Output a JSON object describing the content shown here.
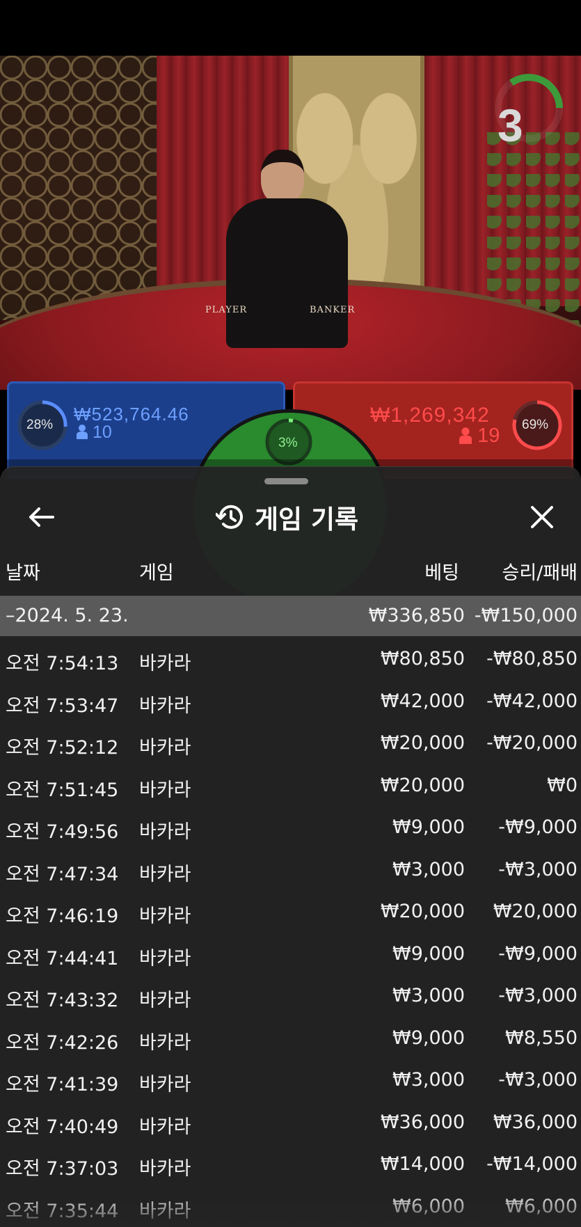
{
  "stream": {
    "countdown": "3",
    "table_left_text": "PLAYER",
    "table_right_text": "BANKER"
  },
  "bets": {
    "player": {
      "percent": "28%",
      "percent_value": 0.28,
      "amount": "₩523,764.46",
      "count": "10"
    },
    "tie": {
      "percent": "3%",
      "percent_value": 0.03
    },
    "banker": {
      "percent": "69%",
      "percent_value": 0.69,
      "amount": "₩1,269,342",
      "count": "19"
    }
  },
  "sheet": {
    "title": "게임 기록",
    "columns": {
      "date": "날짜",
      "game": "게임",
      "bet": "베팅",
      "result": "승리/패배"
    },
    "date_group": {
      "label": "–2024. 5. 23.",
      "bet": "₩336,850",
      "result": "-₩150,000"
    },
    "rows": [
      {
        "time": "오전 7:54:13",
        "game": "바카라",
        "bet": "₩80,850",
        "result": "-₩80,850"
      },
      {
        "time": "오전 7:53:47",
        "game": "바카라",
        "bet": "₩42,000",
        "result": "-₩42,000"
      },
      {
        "time": "오전 7:52:12",
        "game": "바카라",
        "bet": "₩20,000",
        "result": "-₩20,000"
      },
      {
        "time": "오전 7:51:45",
        "game": "바카라",
        "bet": "₩20,000",
        "result": "₩0"
      },
      {
        "time": "오전 7:49:56",
        "game": "바카라",
        "bet": "₩9,000",
        "result": "-₩9,000"
      },
      {
        "time": "오전 7:47:34",
        "game": "바카라",
        "bet": "₩3,000",
        "result": "-₩3,000"
      },
      {
        "time": "오전 7:46:19",
        "game": "바카라",
        "bet": "₩20,000",
        "result": "₩20,000"
      },
      {
        "time": "오전 7:44:41",
        "game": "바카라",
        "bet": "₩9,000",
        "result": "-₩9,000"
      },
      {
        "time": "오전 7:43:32",
        "game": "바카라",
        "bet": "₩3,000",
        "result": "-₩3,000"
      },
      {
        "time": "오전 7:42:26",
        "game": "바카라",
        "bet": "₩9,000",
        "result": "₩8,550"
      },
      {
        "time": "오전 7:41:39",
        "game": "바카라",
        "bet": "₩3,000",
        "result": "-₩3,000"
      },
      {
        "time": "오전 7:40:49",
        "game": "바카라",
        "bet": "₩36,000",
        "result": "₩36,000"
      },
      {
        "time": "오전 7:37:03",
        "game": "바카라",
        "bet": "₩14,000",
        "result": "-₩14,000"
      },
      {
        "time": "오전 7:35:44",
        "game": "바카라",
        "bet": "₩6,000",
        "result": "₩6,000"
      }
    ]
  },
  "icons": {
    "back": "arrow-left-icon",
    "history": "history-clock-icon",
    "close": "close-icon",
    "user": "user-icon"
  },
  "colors": {
    "player": "#1c3f8c",
    "banker": "#a3231f",
    "tie": "#2a8a2e",
    "sheet": "#242424",
    "date_row": "#5a5a5a"
  }
}
